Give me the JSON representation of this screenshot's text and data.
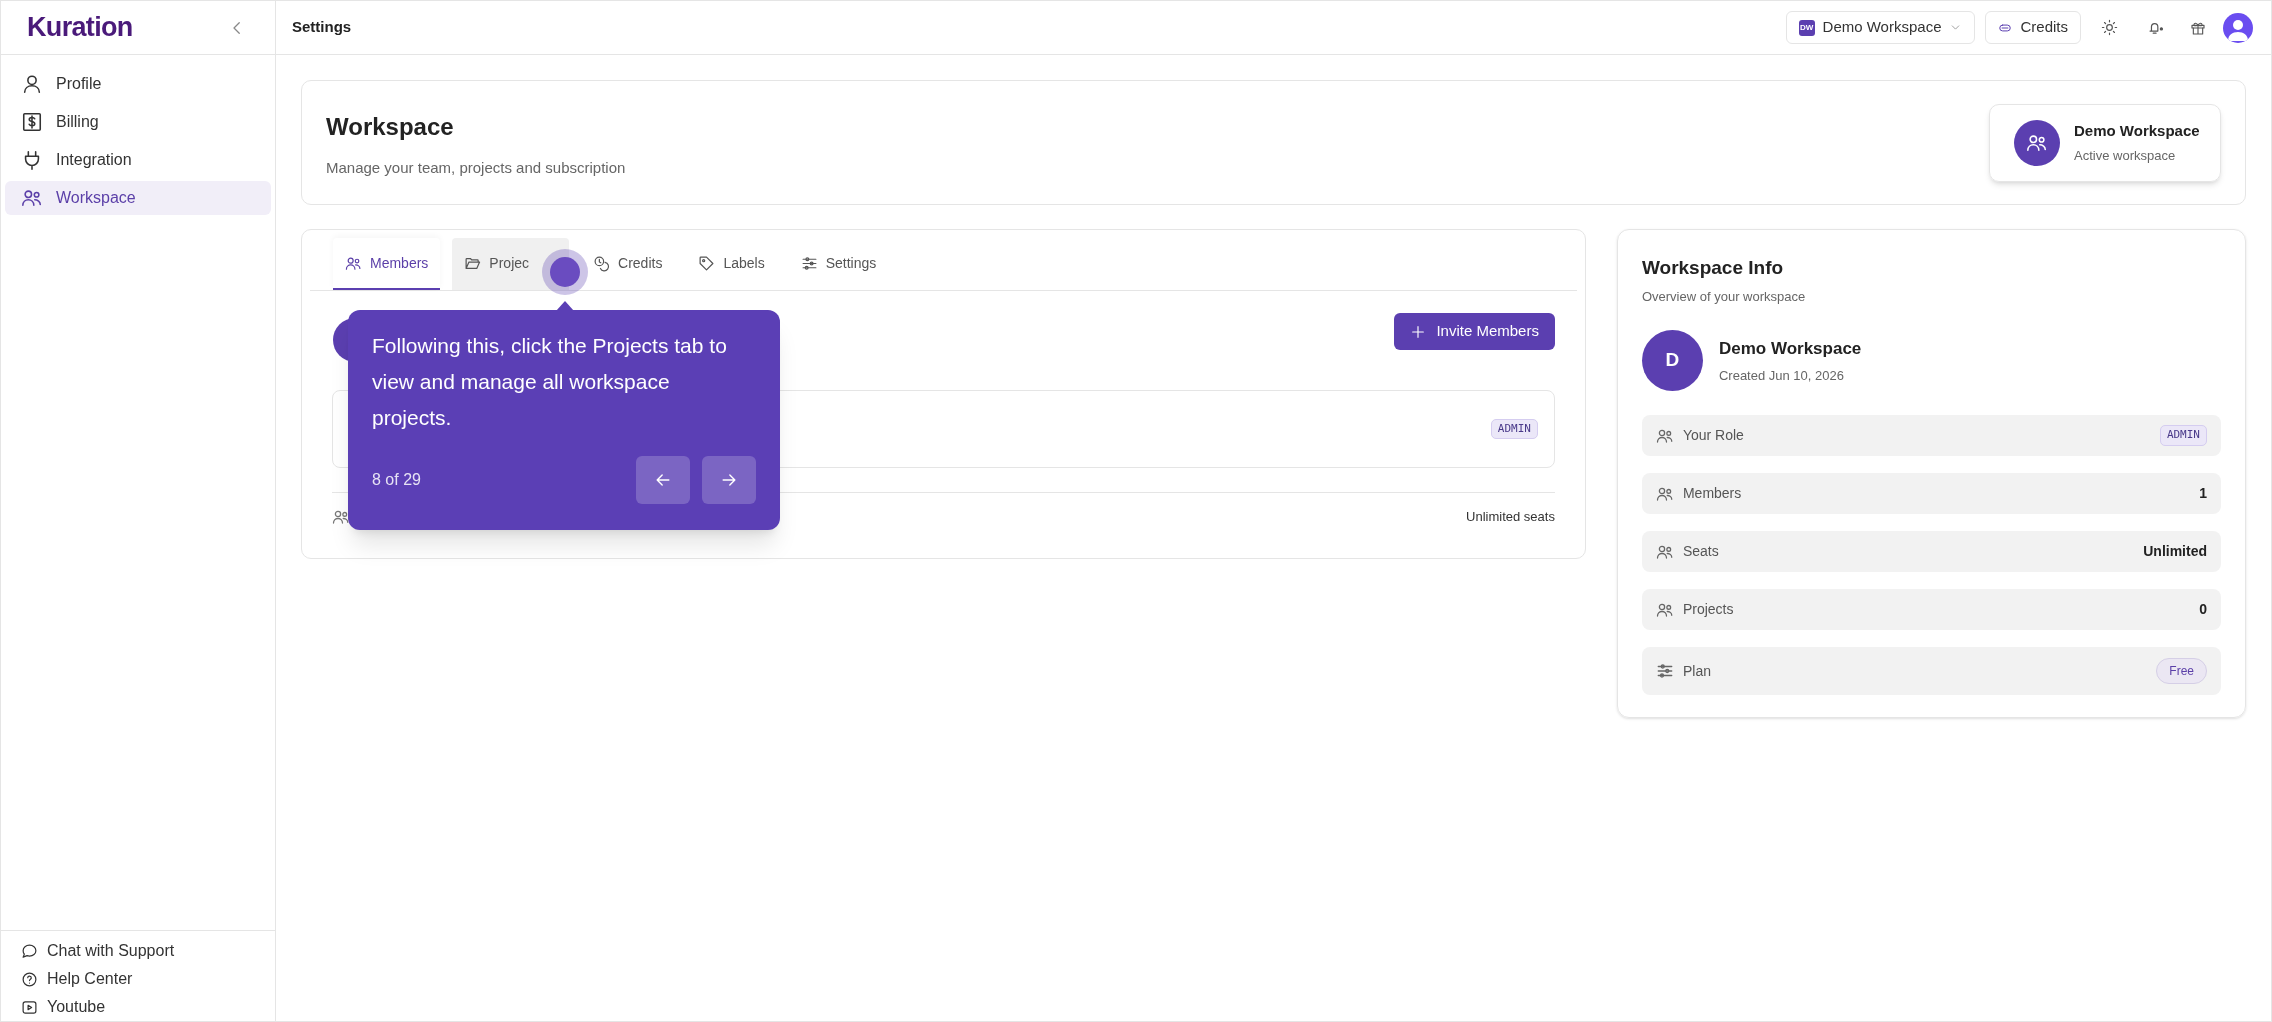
{
  "sidebar": {
    "logo": "Kuration",
    "items": [
      {
        "label": "Profile",
        "selected": false
      },
      {
        "label": "Billing",
        "selected": false
      },
      {
        "label": "Integration",
        "selected": false
      },
      {
        "label": "Workspace",
        "selected": true
      }
    ],
    "footer_links": [
      {
        "label": "Chat with Support"
      },
      {
        "label": "Help Center"
      },
      {
        "label": "Youtube"
      }
    ]
  },
  "topbar": {
    "title": "Settings",
    "workspace_badge": "DW",
    "workspace": "Demo Workspace",
    "credits": "Credits"
  },
  "header": {
    "title": "Workspace",
    "subtitle": "Manage your team, projects and subscription",
    "active_name": "Demo Workspace",
    "active_caption": "Active workspace"
  },
  "tabs": [
    {
      "label": "Members",
      "selected": true,
      "hovered": false
    },
    {
      "label": "Projec",
      "selected": false,
      "hovered": true
    },
    {
      "label": "Credits",
      "selected": false,
      "hovered": false
    },
    {
      "label": "Labels",
      "selected": false,
      "hovered": false
    },
    {
      "label": "Settings",
      "selected": false,
      "hovered": false
    }
  ],
  "members_panel": {
    "invite": "Invite Members",
    "member_role": "ADMIN",
    "seats": "Unlimited seats"
  },
  "tooltip": {
    "text": "Following this, click the Projects tab to view and manage all workspace projects.",
    "step": "8 of 29"
  },
  "info": {
    "title": "Workspace Info",
    "subtitle": "Overview of your workspace",
    "avatar": "D",
    "name": "Demo Workspace",
    "created": "Created Jun 10, 2026",
    "rows": [
      {
        "label": "Your Role",
        "value": "ADMIN",
        "kind": "role"
      },
      {
        "label": "Members",
        "value": "1",
        "kind": "text"
      },
      {
        "label": "Seats",
        "value": "Unlimited",
        "kind": "text"
      },
      {
        "label": "Projects",
        "value": "0",
        "kind": "text"
      },
      {
        "label": "Plan",
        "value": "Free",
        "kind": "pill"
      }
    ]
  }
}
